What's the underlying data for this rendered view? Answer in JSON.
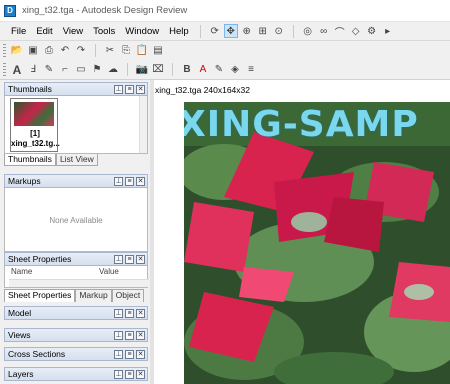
{
  "window": {
    "title": "xing_t32.tga - Autodesk Design Review"
  },
  "menu": [
    "File",
    "Edit",
    "View",
    "Tools",
    "Window",
    "Help"
  ],
  "panels": {
    "thumbnails": {
      "title": "Thumbnails",
      "thumb_label_1": "[1]",
      "thumb_label_2": "xing_t32.tg...",
      "tabs": [
        "Thumbnails",
        "List View"
      ]
    },
    "markups": {
      "title": "Markups",
      "empty_text": "None Available"
    },
    "sheet_properties": {
      "title": "Sheet Properties",
      "col_name": "Name",
      "col_value": "Value",
      "tabs": [
        "Sheet Properties",
        "Markup",
        "Object"
      ]
    },
    "collapsed": [
      "Model",
      "Views",
      "Cross Sections",
      "Layers"
    ]
  },
  "document": {
    "label": "xing_t32.tga 240x164x32",
    "image_caption": "XING-SAMP"
  },
  "colors": {
    "accent": "#cce4f7",
    "panel_header": "#d5dfee",
    "flower": "#d8234f",
    "leaf": "#3f6e3a"
  }
}
